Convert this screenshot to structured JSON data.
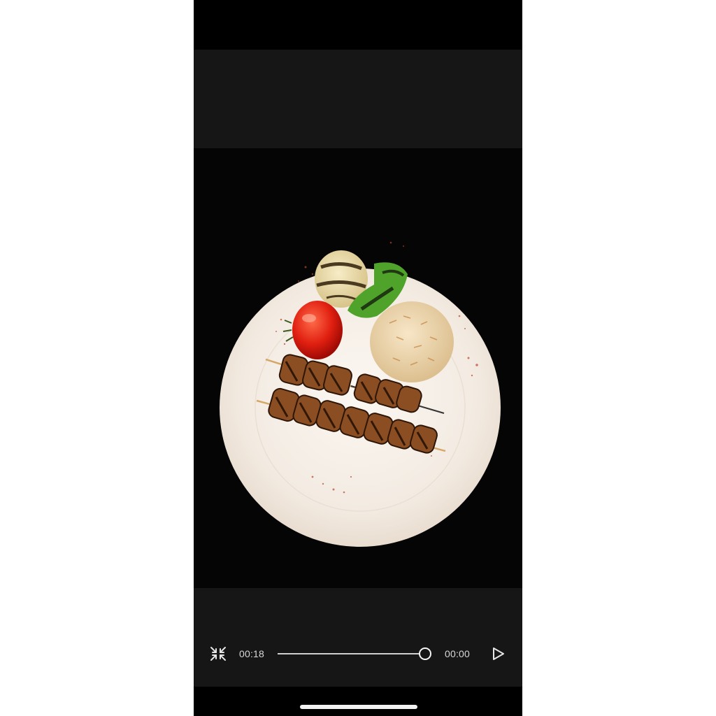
{
  "video": {
    "current_time": "00:18",
    "remaining_time": "00:00",
    "progress": 1.0
  },
  "icons": {
    "minimize": "minimize-icon",
    "play": "play-icon"
  },
  "colors": {
    "control_bar": "#161616",
    "video_background": "#050505",
    "text": "#d8d8d8"
  }
}
